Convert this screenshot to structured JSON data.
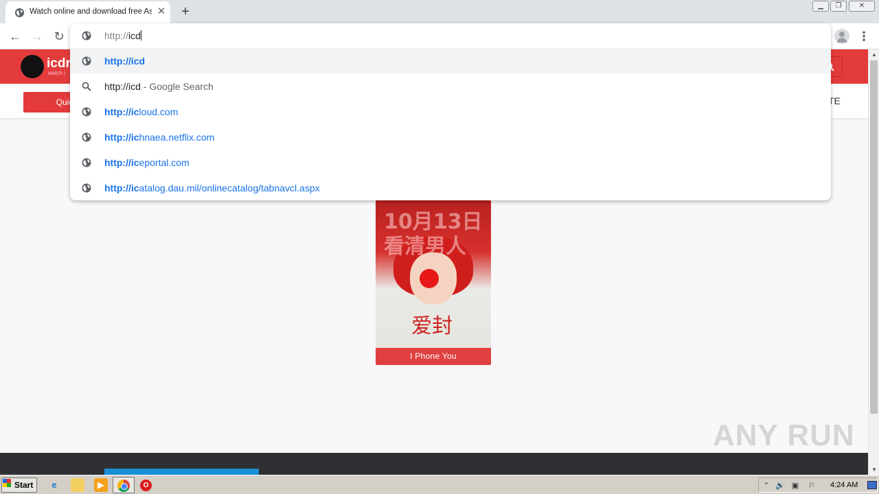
{
  "tab": {
    "title": "Watch online and download free Asian drama",
    "close_glyph": "✕"
  },
  "toolbar": {
    "back_glyph": "←",
    "forward_glyph": "→",
    "reload_glyph": "↻",
    "menu_glyph": "⋮",
    "new_tab_glyph": "+"
  },
  "omnibox": {
    "input_scheme": "http://",
    "input_host": "icd",
    "suggestions": [
      {
        "icon": "globe-icon",
        "bold": "http://icd",
        "rest": "",
        "suffix": "",
        "kind": "url",
        "selected": true
      },
      {
        "icon": "search-icon",
        "bold": "",
        "rest": "http://icd",
        "suffix": " - Google Search",
        "kind": "search",
        "selected": false
      },
      {
        "icon": "globe-icon",
        "bold": "http://ic",
        "rest": "loud.com",
        "suffix": "",
        "kind": "url",
        "selected": false
      },
      {
        "icon": "globe-icon",
        "bold": "http://ic",
        "rest": "hnaea.netflix.com",
        "suffix": "",
        "kind": "url",
        "selected": false
      },
      {
        "icon": "globe-icon",
        "bold": "http://ic",
        "rest": "eportal.com",
        "suffix": "",
        "kind": "url",
        "selected": false
      },
      {
        "icon": "globe-icon",
        "bold": "http://ic",
        "rest": "atalog.dau.mil/onlinecatalog/tabnavcl.aspx",
        "suffix": "",
        "kind": "url",
        "selected": false
      }
    ]
  },
  "site": {
    "logo_text": "icdra",
    "logo_sub": "watch i",
    "quick_button": "Quic",
    "subnav_right": "TE",
    "search_glyph": "🔍"
  },
  "poster": {
    "cn_line1": "10月13日",
    "cn_line2": "看清男人",
    "cn_title": "爱封",
    "caption": "I Phone You"
  },
  "watermark": "ANY RUN",
  "taskbar": {
    "start_label": "Start",
    "clock": "4:24 AM"
  },
  "colors": {
    "brand_red": "#e33b3b",
    "link_blue": "#1a73e8",
    "footer": "#2f3034",
    "footer_accent": "#1a8fd6"
  }
}
